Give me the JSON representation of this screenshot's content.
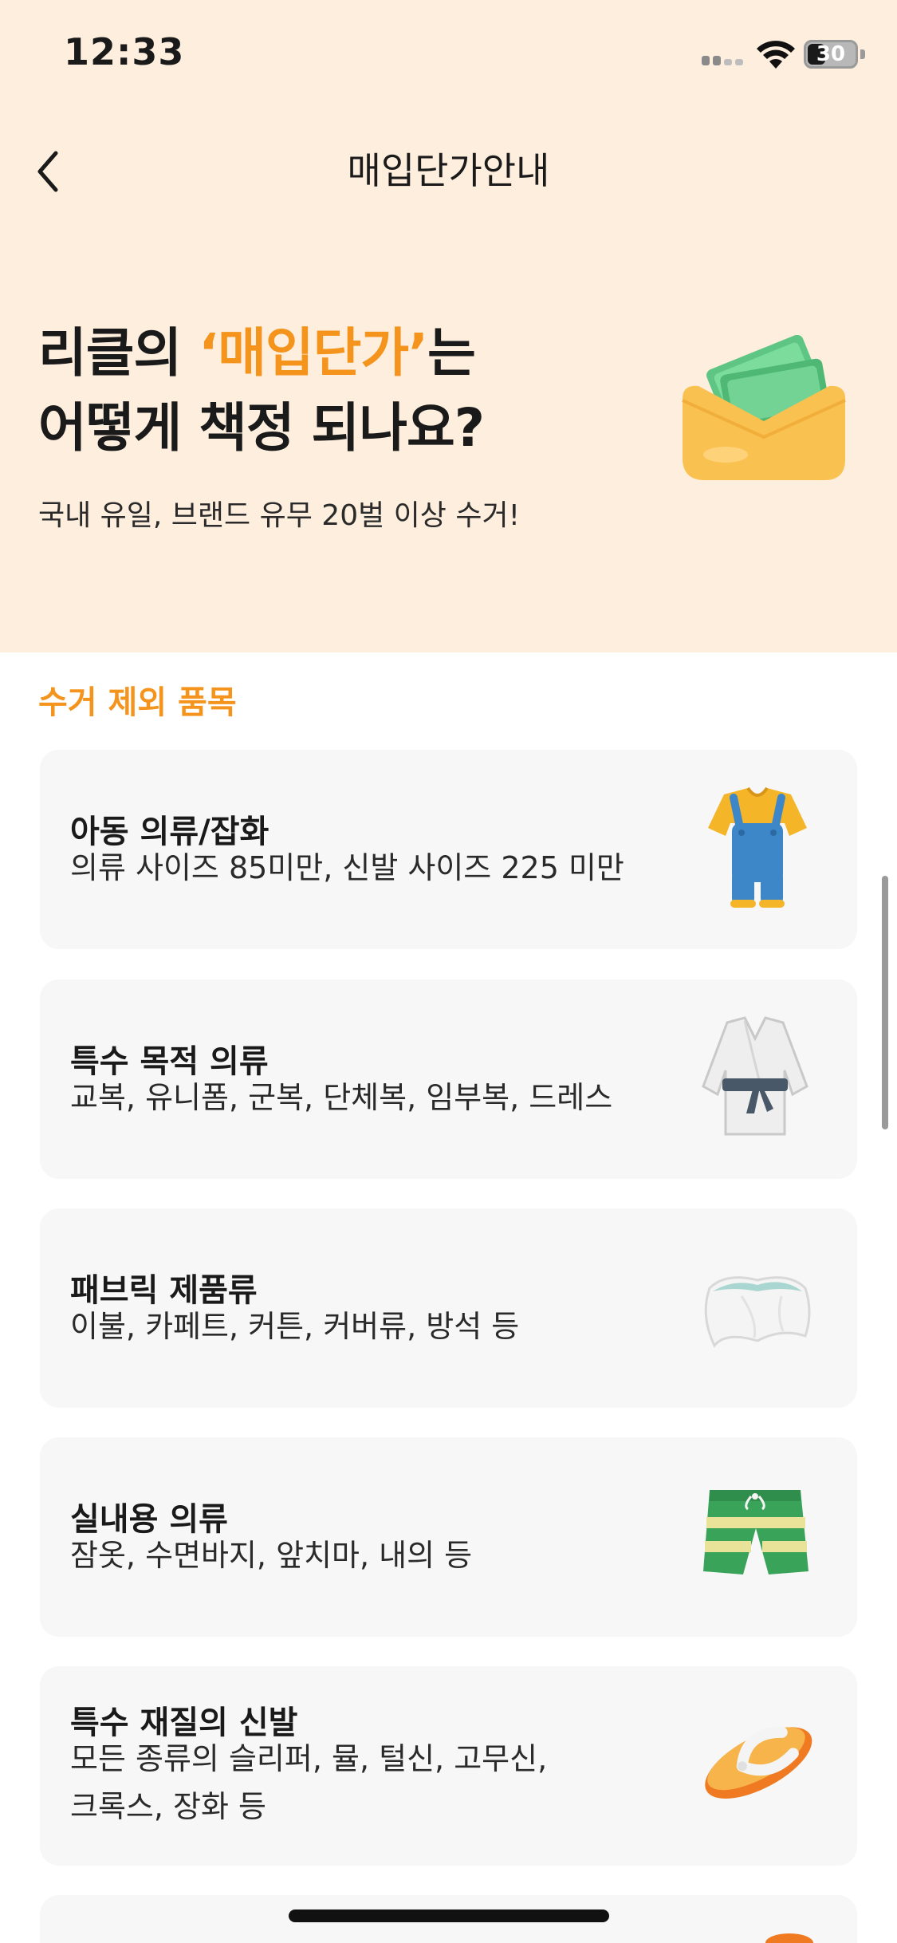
{
  "status_bar": {
    "time": "12:33",
    "battery": "30"
  },
  "nav": {
    "title": "매입단가안내"
  },
  "hero": {
    "title_line1_prefix": "리클의 ",
    "title_line1_accent": "‘매입단가’",
    "title_line1_suffix": "는",
    "title_line2": "어떻게 책정 되나요?",
    "subtitle": "국내 유일, 브랜드 유무 20벌 이상 수거!"
  },
  "section": {
    "label": "수거 제외 품목"
  },
  "items": [
    {
      "title": "아동 의류/잡화",
      "desc": "의류 사이즈 85미만, 신발 사이즈 225 미만",
      "icon": "kids-overalls-icon"
    },
    {
      "title": "특수 목적 의류",
      "desc": "교복, 유니폼, 군복, 단체복, 임부복, 드레스",
      "icon": "uniform-robe-icon"
    },
    {
      "title": "패브릭 제품류",
      "desc": "이불, 카페트, 커튼, 커버류, 방석 등",
      "icon": "pillow-icon"
    },
    {
      "title": "실내용 의류",
      "desc": "잠옷, 수면바지, 앞치마, 내의 등",
      "icon": "shorts-icon"
    },
    {
      "title": "특수 재질의 신발",
      "desc": "모든 종류의 슬리퍼, 뮬, 털신, 고무신,\n크록스, 장화 등",
      "icon": "flip-flop-icon"
    }
  ],
  "colors": {
    "accent": "#f5941d",
    "hero_bg": "#fdeedd",
    "card_bg": "#f7f7f7"
  }
}
